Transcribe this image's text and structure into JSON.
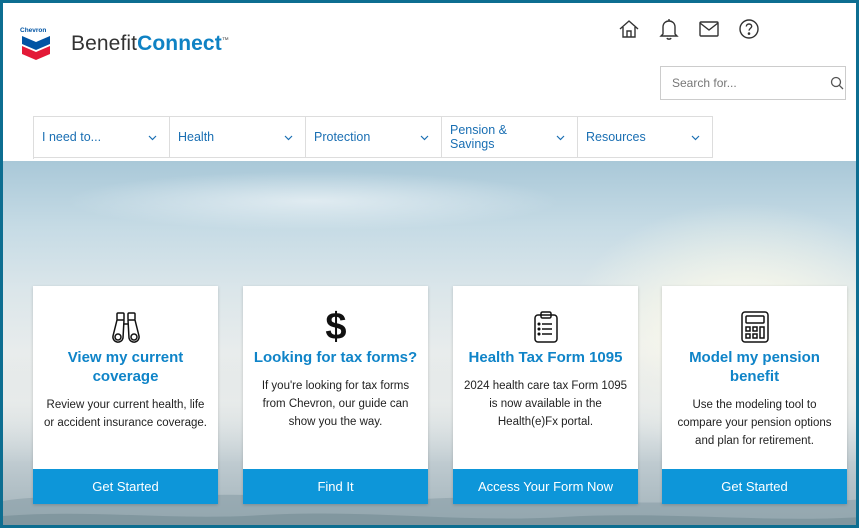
{
  "brand": {
    "logo_word": "Chevron",
    "name_part1": "Benefit",
    "name_part2": "Connect",
    "tm": "™"
  },
  "top_icons": [
    "home-icon",
    "bell-icon",
    "mail-icon",
    "help-icon"
  ],
  "search": {
    "placeholder": "Search for..."
  },
  "nav": [
    {
      "label": "I need to..."
    },
    {
      "label": "Health"
    },
    {
      "label": "Protection"
    },
    {
      "label": "Pension & Savings"
    },
    {
      "label": "Resources"
    }
  ],
  "cards": [
    {
      "icon": "binoculars-icon",
      "title": "View my current coverage",
      "body": "Review your current health, life or accident insurance coverage.",
      "button": "Get Started"
    },
    {
      "icon": "dollar-icon",
      "title": "Looking for tax forms?",
      "body": "If you're looking for tax forms from Chevron, our guide can show you the way.",
      "button": "Find It"
    },
    {
      "icon": "clipboard-icon",
      "title": "Health Tax Form 1095",
      "body": "2024 health care tax Form 1095 is now available in the Health(e)Fx portal.",
      "button": "Access Your Form Now"
    },
    {
      "icon": "calculator-icon",
      "title": "Model my pension benefit",
      "body": "Use the modeling tool to compare your pension options and plan for retirement.",
      "button": "Get Started"
    }
  ],
  "colors": {
    "accent": "#0f84c8",
    "button": "#0d96d9",
    "frame": "#0d6e91"
  }
}
